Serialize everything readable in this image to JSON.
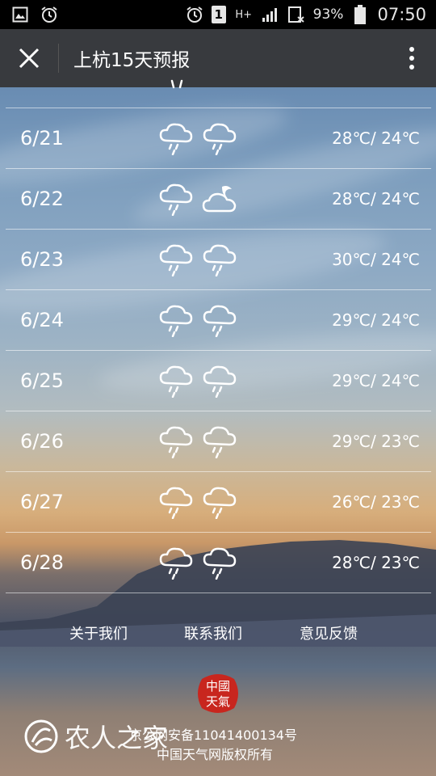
{
  "status_bar": {
    "battery_percent": "93%",
    "time": "07:50",
    "sim_badge": "1",
    "network": "H+"
  },
  "header": {
    "title": "上杭15天预报"
  },
  "forecast": [
    {
      "date": "",
      "temp": ""
    },
    {
      "date": "6/21",
      "day_icon": "rain-cloud-icon",
      "night_icon": "rain-cloud-icon",
      "temp": "28℃/ 24℃"
    },
    {
      "date": "6/22",
      "day_icon": "rain-cloud-icon",
      "night_icon": "cloudy-night-icon",
      "temp": "28℃/ 24℃"
    },
    {
      "date": "6/23",
      "day_icon": "rain-cloud-icon",
      "night_icon": "rain-cloud-icon",
      "temp": "30℃/ 24℃"
    },
    {
      "date": "6/24",
      "day_icon": "rain-cloud-icon",
      "night_icon": "rain-cloud-icon",
      "temp": "29℃/ 24℃"
    },
    {
      "date": "6/25",
      "day_icon": "rain-cloud-icon",
      "night_icon": "rain-cloud-icon",
      "temp": "29℃/ 24℃"
    },
    {
      "date": "6/26",
      "day_icon": "rain-cloud-icon",
      "night_icon": "rain-cloud-icon",
      "temp": "29℃/ 23℃"
    },
    {
      "date": "6/27",
      "day_icon": "rain-cloud-icon",
      "night_icon": "rain-cloud-icon",
      "temp": "26℃/ 23℃"
    },
    {
      "date": "6/28",
      "day_icon": "rain-cloud-icon",
      "night_icon": "rain-cloud-icon",
      "temp": "28℃/ 23℃"
    }
  ],
  "footer": {
    "links": [
      "关于我们",
      "联系我们",
      "意见反馈"
    ],
    "icp": "京公网安备11041400134号",
    "copyright": "中国天气网版权所有",
    "seal_text": "中国天气"
  },
  "watermark": {
    "text": "农人之家"
  },
  "colors": {
    "header_bg": "#383a3e",
    "statusbar_bg": "#000000",
    "seal_red": "#c8261e"
  }
}
